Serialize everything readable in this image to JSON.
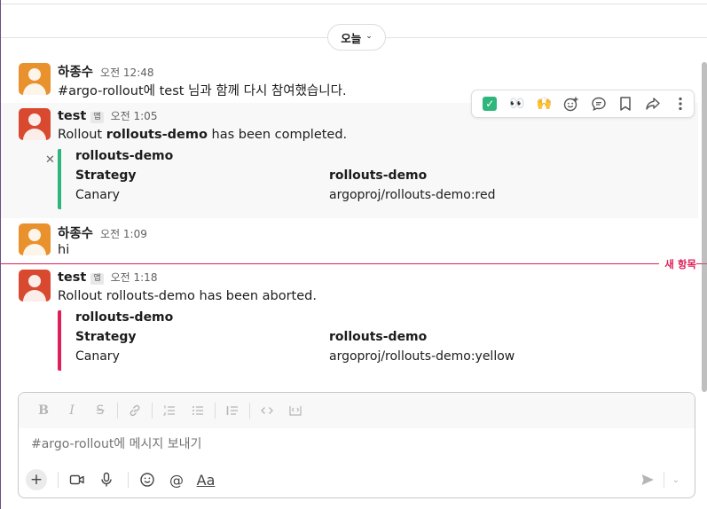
{
  "day_divider": {
    "label": "오늘"
  },
  "messages": [
    {
      "sender": "하종수",
      "time": "오전 12:48",
      "text": "#argo-rollout에 test 님과 함께 다시 참여했습니다."
    },
    {
      "sender": "test",
      "app_badge": "앱",
      "time": "오전 1:05",
      "text_prefix": "Rollout ",
      "text_bold": "rollouts-demo",
      "text_suffix": " has been completed.",
      "attachment": {
        "color": "#2eb67d",
        "title": "rollouts-demo",
        "field1_label": "Strategy",
        "field1_value": "rollouts-demo",
        "field2_label": "Canary",
        "field2_value": "argoproj/rollouts-demo:red"
      }
    },
    {
      "sender": "하종수",
      "time": "오전 1:09",
      "text": "hi"
    },
    {
      "sender": "test",
      "app_badge": "앱",
      "time": "오전 1:18",
      "text": "Rollout rollouts-demo has been aborted.",
      "attachment": {
        "color": "#e01e5a",
        "title": "rollouts-demo",
        "field1_label": "Strategy",
        "field1_value": "rollouts-demo",
        "field2_label": "Canary",
        "field2_value": "argoproj/rollouts-demo:yellow"
      }
    }
  ],
  "new_items_label": "새 항목",
  "hover_toolbar": [
    "check-mark",
    "eyes",
    "raised-hands",
    "add-reaction",
    "reply-thread",
    "bookmark",
    "share",
    "more"
  ],
  "composer": {
    "placeholder": "#argo-rollout에 메시지 보내기",
    "formatting": [
      "bold",
      "italic",
      "strikethrough",
      "link",
      "ordered-list",
      "bulleted-list",
      "blockquote",
      "code",
      "code-block"
    ],
    "text_format_label": "Aa"
  },
  "colors": {
    "new_divider": "#e01e5a",
    "completed": "#2eb67d",
    "aborted": "#e01e5a"
  }
}
